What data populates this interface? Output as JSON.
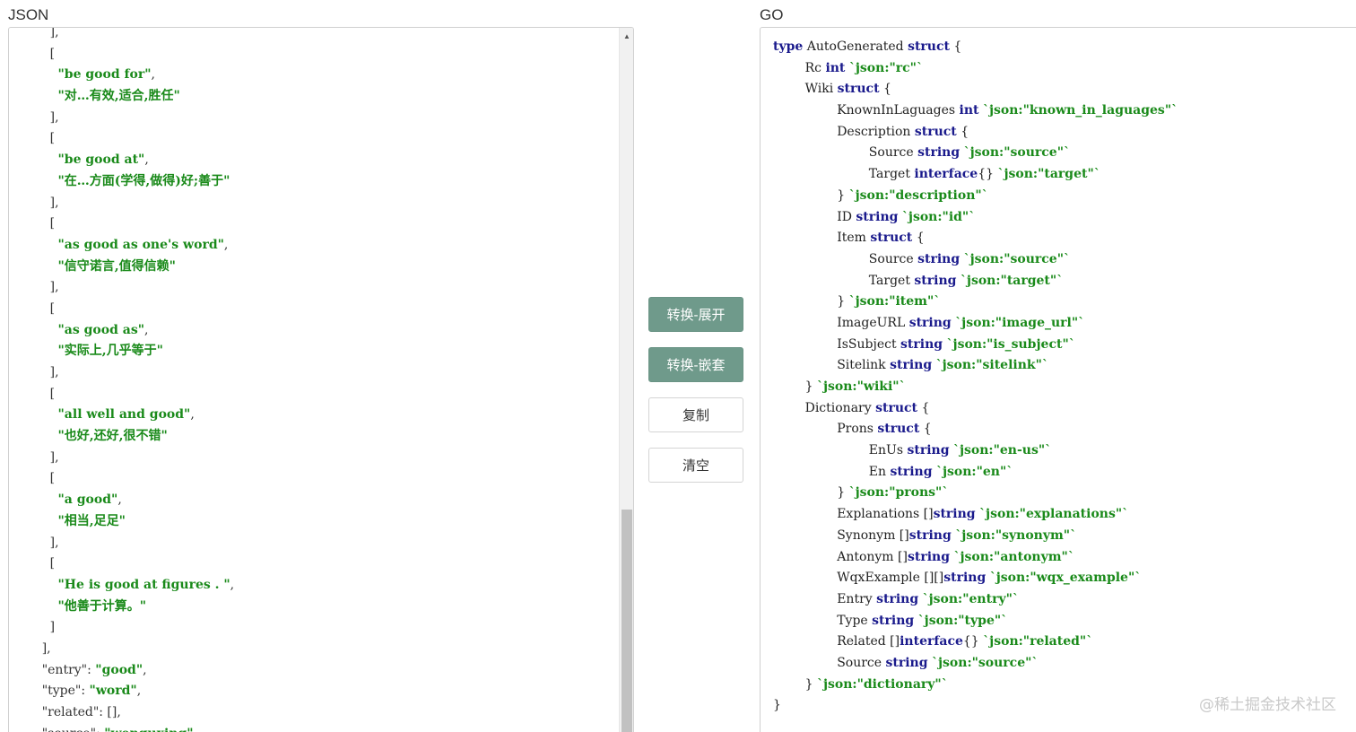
{
  "labels": {
    "json_title": "JSON",
    "go_title": "GO"
  },
  "buttons": {
    "expand": "转换-展开",
    "nest": "转换-嵌套",
    "copy": "复制",
    "clear": "清空"
  },
  "watermark": "@稀土掘金技术社区",
  "colors": {
    "primary_button": "#6f9a8b",
    "string": "#1a8a1a",
    "keyword": "#1a1a8c"
  },
  "json_lines": [
    [
      {
        "t": "        ],",
        "c": "key"
      }
    ],
    [
      {
        "t": "        [",
        "c": "key"
      }
    ],
    [
      {
        "t": "          ",
        "c": "key"
      },
      {
        "t": "\"be good for\"",
        "c": "str"
      },
      {
        "t": ",",
        "c": "key"
      }
    ],
    [
      {
        "t": "          ",
        "c": "key"
      },
      {
        "t": "\"对…有效,适合,胜任\"",
        "c": "str"
      }
    ],
    [
      {
        "t": "        ],",
        "c": "key"
      }
    ],
    [
      {
        "t": "        [",
        "c": "key"
      }
    ],
    [
      {
        "t": "          ",
        "c": "key"
      },
      {
        "t": "\"be good at\"",
        "c": "str"
      },
      {
        "t": ",",
        "c": "key"
      }
    ],
    [
      {
        "t": "          ",
        "c": "key"
      },
      {
        "t": "\"在…方面(学得,做得)好;善于\"",
        "c": "str"
      }
    ],
    [
      {
        "t": "        ],",
        "c": "key"
      }
    ],
    [
      {
        "t": "        [",
        "c": "key"
      }
    ],
    [
      {
        "t": "          ",
        "c": "key"
      },
      {
        "t": "\"as good as one's word\"",
        "c": "str"
      },
      {
        "t": ",",
        "c": "key"
      }
    ],
    [
      {
        "t": "          ",
        "c": "key"
      },
      {
        "t": "\"信守诺言,值得信赖\"",
        "c": "str"
      }
    ],
    [
      {
        "t": "        ],",
        "c": "key"
      }
    ],
    [
      {
        "t": "        [",
        "c": "key"
      }
    ],
    [
      {
        "t": "          ",
        "c": "key"
      },
      {
        "t": "\"as good as\"",
        "c": "str"
      },
      {
        "t": ",",
        "c": "key"
      }
    ],
    [
      {
        "t": "          ",
        "c": "key"
      },
      {
        "t": "\"实际上,几乎等于\"",
        "c": "str"
      }
    ],
    [
      {
        "t": "        ],",
        "c": "key"
      }
    ],
    [
      {
        "t": "        [",
        "c": "key"
      }
    ],
    [
      {
        "t": "          ",
        "c": "key"
      },
      {
        "t": "\"all well and good\"",
        "c": "str"
      },
      {
        "t": ",",
        "c": "key"
      }
    ],
    [
      {
        "t": "          ",
        "c": "key"
      },
      {
        "t": "\"也好,还好,很不错\"",
        "c": "str"
      }
    ],
    [
      {
        "t": "        ],",
        "c": "key"
      }
    ],
    [
      {
        "t": "        [",
        "c": "key"
      }
    ],
    [
      {
        "t": "          ",
        "c": "key"
      },
      {
        "t": "\"a good\"",
        "c": "str"
      },
      {
        "t": ",",
        "c": "key"
      }
    ],
    [
      {
        "t": "          ",
        "c": "key"
      },
      {
        "t": "\"相当,足足\"",
        "c": "str"
      }
    ],
    [
      {
        "t": "        ],",
        "c": "key"
      }
    ],
    [
      {
        "t": "        [",
        "c": "key"
      }
    ],
    [
      {
        "t": "          ",
        "c": "key"
      },
      {
        "t": "\"He is good at figures . \"",
        "c": "str"
      },
      {
        "t": ",",
        "c": "key"
      }
    ],
    [
      {
        "t": "          ",
        "c": "key"
      },
      {
        "t": "\"他善于计算。\"",
        "c": "str"
      }
    ],
    [
      {
        "t": "        ]",
        "c": "key"
      }
    ],
    [
      {
        "t": "      ],",
        "c": "key"
      }
    ],
    [
      {
        "t": "      \"entry\": ",
        "c": "key"
      },
      {
        "t": "\"good\"",
        "c": "str"
      },
      {
        "t": ",",
        "c": "key"
      }
    ],
    [
      {
        "t": "      \"type\": ",
        "c": "key"
      },
      {
        "t": "\"word\"",
        "c": "str"
      },
      {
        "t": ",",
        "c": "key"
      }
    ],
    [
      {
        "t": "      \"related\": [],",
        "c": "key"
      }
    ],
    [
      {
        "t": "      \"source\": ",
        "c": "key"
      },
      {
        "t": "\"wenquxing\"",
        "c": "str"
      }
    ]
  ],
  "go_lines": [
    [
      {
        "t": "type",
        "c": "kw"
      },
      {
        "t": " AutoGenerated ",
        "c": "id"
      },
      {
        "t": "struct",
        "c": "kw"
      },
      {
        "t": " {",
        "c": "id"
      }
    ],
    [
      {
        "t": "        Rc ",
        "c": "id"
      },
      {
        "t": "int",
        "c": "kw"
      },
      {
        "t": " ",
        "c": "id"
      },
      {
        "t": "`json:\"rc\"`",
        "c": "tag"
      }
    ],
    [
      {
        "t": "        Wiki ",
        "c": "id"
      },
      {
        "t": "struct",
        "c": "kw"
      },
      {
        "t": " {",
        "c": "id"
      }
    ],
    [
      {
        "t": "                KnownInLaguages ",
        "c": "id"
      },
      {
        "t": "int",
        "c": "kw"
      },
      {
        "t": " ",
        "c": "id"
      },
      {
        "t": "`json:\"known_in_laguages\"`",
        "c": "tag"
      }
    ],
    [
      {
        "t": "                Description ",
        "c": "id"
      },
      {
        "t": "struct",
        "c": "kw"
      },
      {
        "t": " {",
        "c": "id"
      }
    ],
    [
      {
        "t": "                        Source ",
        "c": "id"
      },
      {
        "t": "string",
        "c": "kw"
      },
      {
        "t": " ",
        "c": "id"
      },
      {
        "t": "`json:\"source\"`",
        "c": "tag"
      }
    ],
    [
      {
        "t": "                        Target ",
        "c": "id"
      },
      {
        "t": "interface",
        "c": "kw"
      },
      {
        "t": "{} ",
        "c": "id"
      },
      {
        "t": "`json:\"target\"`",
        "c": "tag"
      }
    ],
    [
      {
        "t": "                } ",
        "c": "id"
      },
      {
        "t": "`json:\"description\"`",
        "c": "tag"
      }
    ],
    [
      {
        "t": "                ID ",
        "c": "id"
      },
      {
        "t": "string",
        "c": "kw"
      },
      {
        "t": " ",
        "c": "id"
      },
      {
        "t": "`json:\"id\"`",
        "c": "tag"
      }
    ],
    [
      {
        "t": "                Item ",
        "c": "id"
      },
      {
        "t": "struct",
        "c": "kw"
      },
      {
        "t": " {",
        "c": "id"
      }
    ],
    [
      {
        "t": "                        Source ",
        "c": "id"
      },
      {
        "t": "string",
        "c": "kw"
      },
      {
        "t": " ",
        "c": "id"
      },
      {
        "t": "`json:\"source\"`",
        "c": "tag"
      }
    ],
    [
      {
        "t": "                        Target ",
        "c": "id"
      },
      {
        "t": "string",
        "c": "kw"
      },
      {
        "t": " ",
        "c": "id"
      },
      {
        "t": "`json:\"target\"`",
        "c": "tag"
      }
    ],
    [
      {
        "t": "                } ",
        "c": "id"
      },
      {
        "t": "`json:\"item\"`",
        "c": "tag"
      }
    ],
    [
      {
        "t": "                ImageURL ",
        "c": "id"
      },
      {
        "t": "string",
        "c": "kw"
      },
      {
        "t": " ",
        "c": "id"
      },
      {
        "t": "`json:\"image_url\"`",
        "c": "tag"
      }
    ],
    [
      {
        "t": "                IsSubject ",
        "c": "id"
      },
      {
        "t": "string",
        "c": "kw"
      },
      {
        "t": " ",
        "c": "id"
      },
      {
        "t": "`json:\"is_subject\"`",
        "c": "tag"
      }
    ],
    [
      {
        "t": "                Sitelink ",
        "c": "id"
      },
      {
        "t": "string",
        "c": "kw"
      },
      {
        "t": " ",
        "c": "id"
      },
      {
        "t": "`json:\"sitelink\"`",
        "c": "tag"
      }
    ],
    [
      {
        "t": "        } ",
        "c": "id"
      },
      {
        "t": "`json:\"wiki\"`",
        "c": "tag"
      }
    ],
    [
      {
        "t": "        Dictionary ",
        "c": "id"
      },
      {
        "t": "struct",
        "c": "kw"
      },
      {
        "t": " {",
        "c": "id"
      }
    ],
    [
      {
        "t": "                Prons ",
        "c": "id"
      },
      {
        "t": "struct",
        "c": "kw"
      },
      {
        "t": " {",
        "c": "id"
      }
    ],
    [
      {
        "t": "                        EnUs ",
        "c": "id"
      },
      {
        "t": "string",
        "c": "kw"
      },
      {
        "t": " ",
        "c": "id"
      },
      {
        "t": "`json:\"en-us\"`",
        "c": "tag"
      }
    ],
    [
      {
        "t": "                        En ",
        "c": "id"
      },
      {
        "t": "string",
        "c": "kw"
      },
      {
        "t": " ",
        "c": "id"
      },
      {
        "t": "`json:\"en\"`",
        "c": "tag"
      }
    ],
    [
      {
        "t": "                } ",
        "c": "id"
      },
      {
        "t": "`json:\"prons\"`",
        "c": "tag"
      }
    ],
    [
      {
        "t": "                Explanations []",
        "c": "id"
      },
      {
        "t": "string",
        "c": "kw"
      },
      {
        "t": " ",
        "c": "id"
      },
      {
        "t": "`json:\"explanations\"`",
        "c": "tag"
      }
    ],
    [
      {
        "t": "                Synonym []",
        "c": "id"
      },
      {
        "t": "string",
        "c": "kw"
      },
      {
        "t": " ",
        "c": "id"
      },
      {
        "t": "`json:\"synonym\"`",
        "c": "tag"
      }
    ],
    [
      {
        "t": "                Antonym []",
        "c": "id"
      },
      {
        "t": "string",
        "c": "kw"
      },
      {
        "t": " ",
        "c": "id"
      },
      {
        "t": "`json:\"antonym\"`",
        "c": "tag"
      }
    ],
    [
      {
        "t": "                WqxExample [][]",
        "c": "id"
      },
      {
        "t": "string",
        "c": "kw"
      },
      {
        "t": " ",
        "c": "id"
      },
      {
        "t": "`json:\"wqx_example\"`",
        "c": "tag"
      }
    ],
    [
      {
        "t": "                Entry ",
        "c": "id"
      },
      {
        "t": "string",
        "c": "kw"
      },
      {
        "t": " ",
        "c": "id"
      },
      {
        "t": "`json:\"entry\"`",
        "c": "tag"
      }
    ],
    [
      {
        "t": "                Type ",
        "c": "id"
      },
      {
        "t": "string",
        "c": "kw"
      },
      {
        "t": " ",
        "c": "id"
      },
      {
        "t": "`json:\"type\"`",
        "c": "tag"
      }
    ],
    [
      {
        "t": "                Related []",
        "c": "id"
      },
      {
        "t": "interface",
        "c": "kw"
      },
      {
        "t": "{} ",
        "c": "id"
      },
      {
        "t": "`json:\"related\"`",
        "c": "tag"
      }
    ],
    [
      {
        "t": "                Source ",
        "c": "id"
      },
      {
        "t": "string",
        "c": "kw"
      },
      {
        "t": " ",
        "c": "id"
      },
      {
        "t": "`json:\"source\"`",
        "c": "tag"
      }
    ],
    [
      {
        "t": "        } ",
        "c": "id"
      },
      {
        "t": "`json:\"dictionary\"`",
        "c": "tag"
      }
    ],
    [
      {
        "t": "}",
        "c": "id"
      }
    ]
  ]
}
